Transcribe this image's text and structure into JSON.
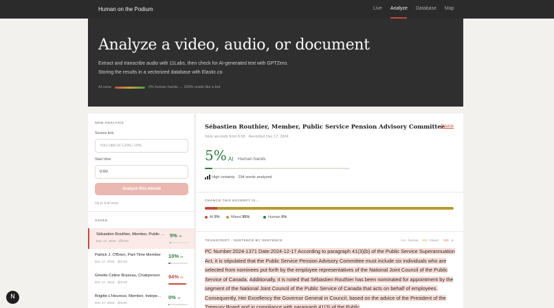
{
  "app": {
    "brand": "Human on the Podium",
    "nav": [
      "Live",
      "Analyze",
      "Database",
      "Map"
    ],
    "active_nav": "Analyze"
  },
  "hero": {
    "title": "Analyze a video, audio, or document",
    "desc_line1": "Extract and transcribe audio with 11Labs, then check for AI-generated text with GPTZero.",
    "desc_line2": "Storing the results in a vectorized database with Elastic.co",
    "legend_label": "AI-ness",
    "legend_text": "0% human hands → 100% reads like a bot"
  },
  "new_analysis": {
    "heading": "NEW ANALYSIS",
    "source_label": "Source link",
    "source_placeholder": "YouTube or CPAC URL",
    "start_label": "Start time",
    "start_value": "0:00",
    "button_label": "Analyze this minute",
    "hint": "Up to 4 at once."
  },
  "saved": {
    "heading": "SAVED",
    "ai_suffix": "AI",
    "items": [
      {
        "title": "Sébastien Routhier, Member, Public Service Pension Advisory Committee",
        "meta": "Dec 17, 2024 · @0:00",
        "pct": "5%",
        "fraction": 0.05,
        "color": "#2e7a3e"
      },
      {
        "title": "Patrick J. O'Brien, Part-Time Member",
        "meta": "Dec 17, 2024 · @0:00",
        "pct": "10%",
        "fraction": 0.1,
        "color": "#2e7a3e"
      },
      {
        "title": "Ginette Céline Brazeau, Chairperson",
        "meta": "Dec 17, 2024 · @0:00",
        "pct": "94%",
        "fraction": 0.94,
        "color": "#c24b3a"
      },
      {
        "title": "Brigitte L'Heureux, Member, Independent",
        "meta": "Dec 17, 2024 · @0:00",
        "pct": "0%",
        "fraction": 0.0,
        "color": "#2e7a3e"
      }
    ]
  },
  "detail": {
    "title": "Sébastien Routhier, Member, Public Service Pension Advisory Committee",
    "source_label": "Source",
    "meta": "Sixty seconds from 0:00 · Recorded Dec 17, 2024",
    "score": "5%",
    "score_unit": "AI",
    "verdict": "Human hands",
    "score_fraction": 0.05,
    "certainty": "High certainty",
    "words": "294 words analyzed",
    "chance_heading": "CHANCE THIS EXCERPT IS...",
    "chance": [
      {
        "label": "AI",
        "value": "5%",
        "fraction": 0.05,
        "color": "#c24b3a"
      },
      {
        "label": "Mixed",
        "value": "95%",
        "fraction": 0.95,
        "color": "#b59a35"
      },
      {
        "label": "Human",
        "value": "0%",
        "fraction": 0.0,
        "color": "#2e7a3e"
      }
    ],
    "transcript_heading": "TRANSCRIPT · SENTENCE BY SENTENCE",
    "transcript_legend": [
      "human",
      "mixed",
      "ai"
    ],
    "transcript_colors": {
      "human": "#e6e4df",
      "mixed": "#f0e2bf",
      "ai": "#f5cdc5"
    },
    "sentences": [
      "PC Number:2024-1371  Date:2024-12-17  According to paragraph 41(3)(b) of the Public Service Superannuation Act, it is stipulated that the Public Service Pension Advisory Committee must include six individuals who are selected from nominees put forth by the employee representatives of the National Joint Council of the Public Service of Canada.",
      "Additionally, it is noted that Sébastien Routhier has been nominated for appointment by the segment of the National Joint Council of the Public Service of Canada that acts on behalf of employees.",
      "Consequently, Her Excellency the Governor General in Council, based on the advice of the President of the Treasury Board and in compliance with paragraph 41(3) of the Public"
    ]
  }
}
